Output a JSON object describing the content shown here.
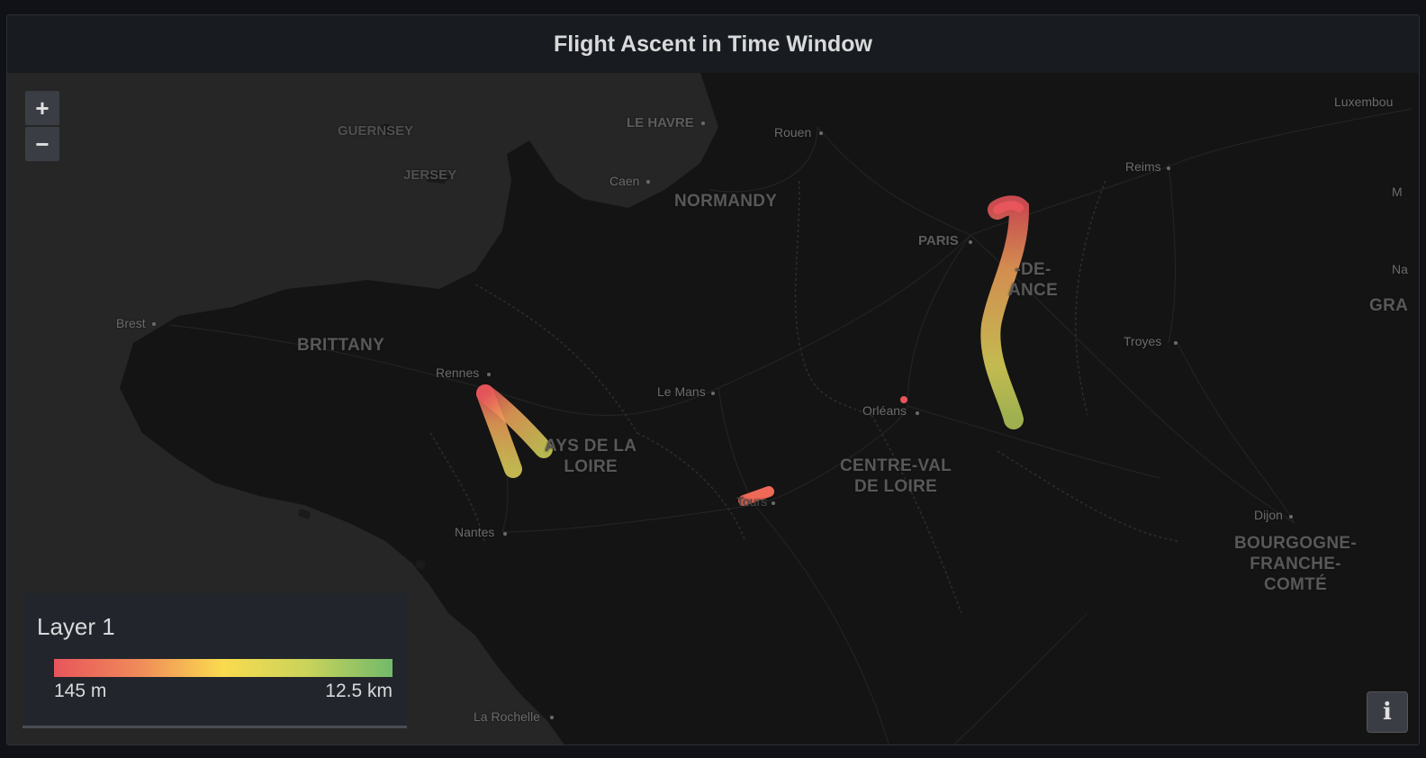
{
  "panel": {
    "title": "Flight Ascent in Time Window"
  },
  "map": {
    "zoom_in_label": "+",
    "zoom_out_label": "−",
    "info_label": "i",
    "places": [
      {
        "id": "guernsey",
        "label": "GUERNSEY",
        "kind": "island"
      },
      {
        "id": "jersey",
        "label": "JERSEY",
        "kind": "island"
      },
      {
        "id": "le-havre",
        "label": "LE HAVRE",
        "kind": "city"
      },
      {
        "id": "rouen",
        "label": "Rouen",
        "kind": "city"
      },
      {
        "id": "caen",
        "label": "Caen",
        "kind": "city"
      },
      {
        "id": "normandy",
        "label": "NORMANDY",
        "kind": "region"
      },
      {
        "id": "paris",
        "label": "PARIS",
        "kind": "city"
      },
      {
        "id": "ile-de-france",
        "label": "-DE-\nANCE",
        "kind": "region"
      },
      {
        "id": "reims",
        "label": "Reims",
        "kind": "city"
      },
      {
        "id": "luxembourg",
        "label": "Luxembou",
        "kind": "city"
      },
      {
        "id": "brest",
        "label": "Brest",
        "kind": "city"
      },
      {
        "id": "brittany",
        "label": "BRITTANY",
        "kind": "region"
      },
      {
        "id": "rennes",
        "label": "Rennes",
        "kind": "city"
      },
      {
        "id": "le-mans",
        "label": "Le Mans",
        "kind": "city"
      },
      {
        "id": "pays-de-la-loire",
        "label": "AYS DE LA\nLOIRE",
        "kind": "region"
      },
      {
        "id": "orleans",
        "label": "Orléans",
        "kind": "city"
      },
      {
        "id": "troyes",
        "label": "Troyes",
        "kind": "city"
      },
      {
        "id": "centre-val-de-loire",
        "label": "CENTRE-VAL\nDE LOIRE",
        "kind": "region"
      },
      {
        "id": "tours",
        "label": "Tours",
        "kind": "city"
      },
      {
        "id": "nantes",
        "label": "Nantes",
        "kind": "city"
      },
      {
        "id": "dijon",
        "label": "Dijon",
        "kind": "city"
      },
      {
        "id": "bourgogne",
        "label": "BOURGOGNE-\nFRANCHE-\nCOMTÉ",
        "kind": "region"
      },
      {
        "id": "la-rochelle",
        "label": "La Rochelle",
        "kind": "city"
      },
      {
        "id": "gra",
        "label": "GRA",
        "kind": "region"
      },
      {
        "id": "edge-m",
        "label": "M",
        "kind": "city"
      },
      {
        "id": "edge-na",
        "label": "Na",
        "kind": "city"
      }
    ],
    "colors": {
      "low": "#e8555b",
      "mid": "#fadb4f",
      "high": "#72ba6b"
    }
  },
  "legend": {
    "title": "Layer 1",
    "min_label": "145 m",
    "max_label": "12.5 km"
  }
}
